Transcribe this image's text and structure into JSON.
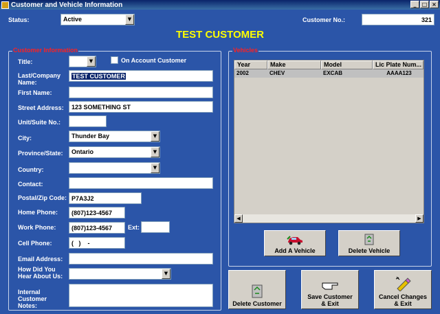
{
  "window": {
    "title": "Customer and Vehicle Information",
    "min": "_",
    "max": "□",
    "close": "×"
  },
  "header": {
    "status_label": "Status:",
    "status_value": "Active",
    "customer_no_label": "Customer No.:",
    "customer_no_value": "321",
    "customer_name": "TEST CUSTOMER"
  },
  "customer_info": {
    "group_title": "Customer Information",
    "title_label": "Title:",
    "title_value": "",
    "on_account_label": "On Account Customer",
    "on_account_checked": false,
    "last_name_label": "Last/Company Name:",
    "last_name_value": "TEST CUSTOMER",
    "first_name_label": "First Name:",
    "first_name_value": "",
    "street_label": "Street Address:",
    "street_value": "123 SOMETHING ST",
    "unit_label": "Unit/Suite No.:",
    "unit_value": "",
    "city_label": "City:",
    "city_value": "Thunder Bay",
    "province_label": "Province/State:",
    "province_value": "Ontario",
    "country_label": "Country:",
    "country_value": "",
    "contact_label": "Contact:",
    "contact_value": "",
    "postal_label": "Postal/Zip Code:",
    "postal_value": "P7A3J2",
    "home_phone_label": "Home Phone:",
    "home_phone_value": "(807)123-4567",
    "work_phone_label": "Work Phone:",
    "work_phone_value": "(807)123-4567",
    "ext_label": "Ext:",
    "ext_value": "",
    "cell_phone_label": "Cell Phone:",
    "cell_phone_value": "(   )    -",
    "email_label": "Email Address:",
    "email_value": "",
    "heard_label": "How Did You Hear About Us:",
    "heard_value": "",
    "notes_label": "Internal Customer Notes:",
    "notes_value": ""
  },
  "vehicles": {
    "group_title": "Vehicles",
    "columns": [
      "Year",
      "Make",
      "Model",
      "Lic Plate Num..."
    ],
    "rows": [
      [
        "2002",
        "CHEV",
        "EXCAB",
        "AAAA123"
      ]
    ],
    "add_button": "Add A Vehicle",
    "delete_button": "Delete Vehicle"
  },
  "actions": {
    "delete_customer": "Delete Customer",
    "save_exit_line1": "Save Customer",
    "save_exit_line2": "& Exit",
    "cancel_line1": "Cancel Changes",
    "cancel_line2": "& Exit"
  },
  "colors": {
    "background": "#2b55a8",
    "title_text": "#ffff00",
    "group_title": "#ff2020"
  }
}
